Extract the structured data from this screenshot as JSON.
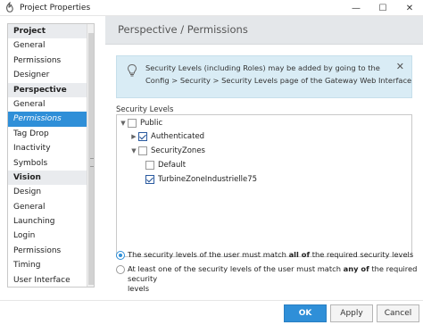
{
  "window": {
    "title": "Project Properties",
    "icon": "ignition-icon",
    "buttons": {
      "minimize": "—",
      "maximize": "☐",
      "close": "✕"
    }
  },
  "sidebar": {
    "groups": [
      {
        "header": "Project",
        "items": [
          "General",
          "Permissions",
          "Designer"
        ]
      },
      {
        "header": "Perspective",
        "items": [
          "General",
          "Permissions",
          "Tag Drop",
          "Inactivity",
          "Symbols"
        ]
      },
      {
        "header": "Vision",
        "items": [
          "Design",
          "General",
          "Launching",
          "Login",
          "Permissions",
          "Timing",
          "User Interface"
        ]
      }
    ],
    "selected": "Perspective/Permissions"
  },
  "panel": {
    "title": "Perspective / Permissions",
    "info": {
      "line1": "Security Levels (including Roles) may be added by going to the",
      "line2": "Config > Security > Security Levels page of the Gateway Web Interface",
      "close": "✕"
    },
    "section_label": "Security Levels",
    "tree": [
      {
        "label": "Public",
        "toggle": "▼",
        "checked": false
      },
      {
        "label": "Authenticated",
        "toggle": "▶",
        "checked": true
      },
      {
        "label": "SecurityZones",
        "toggle": "▼",
        "checked": false
      },
      {
        "label": "Default",
        "toggle": "",
        "checked": false
      },
      {
        "label": "TurbineZoneIndustrielle75",
        "toggle": "",
        "checked": true
      }
    ],
    "radios": {
      "all": {
        "pre": "The security levels of the user must match ",
        "bold": "all of",
        "post": " the required security levels",
        "checked": true
      },
      "any": {
        "pre": "At least one of the security levels of the user must match ",
        "bold": "any of",
        "post": " the required security",
        "line2": "levels",
        "checked": false
      }
    }
  },
  "footer": {
    "ok": "OK",
    "apply": "Apply",
    "cancel": "Cancel"
  },
  "colors": {
    "accent": "#2f8fd8",
    "info_bg": "#d9ecf5",
    "header_bg": "#e4e7ea"
  }
}
